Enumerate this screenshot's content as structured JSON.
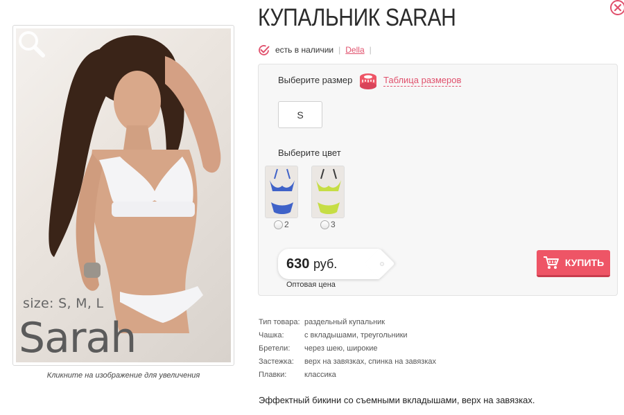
{
  "product": {
    "title": "КУПАЛЬНИК SARAH",
    "availability": "есть в наличии",
    "brand": "Della"
  },
  "image": {
    "overlay_size": "size: S, M, L",
    "overlay_name": "Sarah",
    "caption": "Кликните на изображение для увеличения"
  },
  "options": {
    "size_label": "Выберите размер",
    "size_chart_link": "Таблица размеров",
    "sizes": [
      "S"
    ],
    "color_label": "Выберите цвет",
    "colors": [
      {
        "value": "2",
        "color": "#3f62c8"
      },
      {
        "value": "3",
        "color": "#c6dd44"
      }
    ]
  },
  "purchase": {
    "price": "630",
    "currency": "руб.",
    "price_note": "Оптовая цена",
    "buy_label": "КУПИТЬ",
    "accent_color": "#ee5566"
  },
  "specs": [
    {
      "key": "Тип товара:",
      "value": "раздельный купальник"
    },
    {
      "key": "Чашка:",
      "value": "с вкладышами, треугольники"
    },
    {
      "key": "Бретели:",
      "value": "через шею, широкие"
    },
    {
      "key": "Застежка:",
      "value": "верх на завязках, спинка на завязках"
    },
    {
      "key": "Плавки:",
      "value": "классика"
    }
  ],
  "description": "Эффектный бикини со съемными вкладышами, верх на завязках."
}
